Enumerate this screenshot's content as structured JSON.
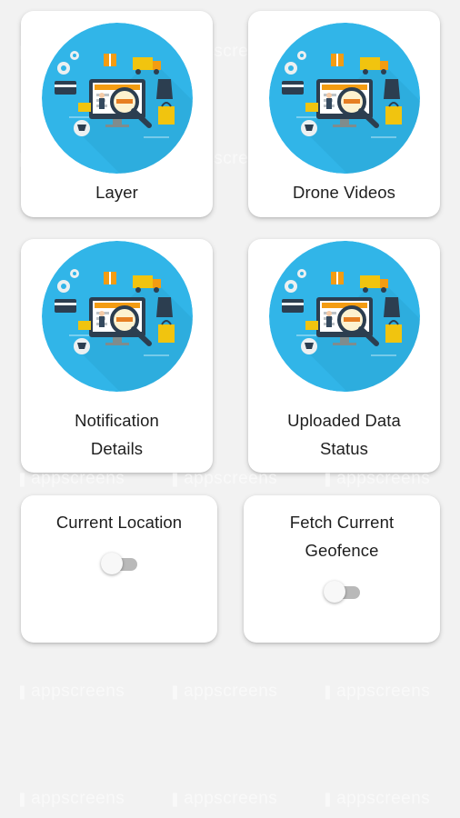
{
  "cards": [
    {
      "label": "Layer"
    },
    {
      "label": "Drone Videos"
    },
    {
      "label": "Notification\nDetails"
    },
    {
      "label": "Uploaded Data\nStatus"
    },
    {
      "label": "Current Location"
    },
    {
      "label": "Fetch Current\nGeofence"
    }
  ],
  "toggles": [
    {
      "state": "off"
    },
    {
      "state": "off"
    }
  ],
  "watermark": "appscreens",
  "colors": {
    "background": "#f2f2f2",
    "card": "#ffffff",
    "circle": "#31b5e8",
    "toggle_track": "#b9b9b9",
    "toggle_knob": "#f8f8f8"
  },
  "icons": [
    "ecommerce-illustration-icon"
  ]
}
